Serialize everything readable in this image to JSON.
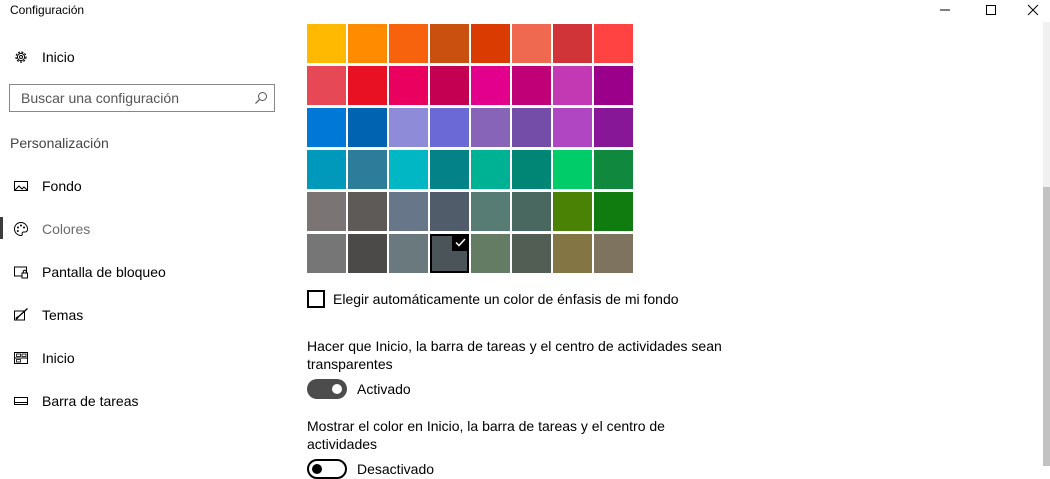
{
  "window": {
    "title": "Configuración"
  },
  "sidebar": {
    "home_label": "Inicio",
    "search_placeholder": "Buscar una configuración",
    "section_title": "Personalización",
    "items": [
      {
        "label": "Fondo",
        "icon": "picture-icon",
        "active": false
      },
      {
        "label": "Colores",
        "icon": "palette-icon",
        "active": true
      },
      {
        "label": "Pantalla de bloqueo",
        "icon": "lock-screen-icon",
        "active": false
      },
      {
        "label": "Temas",
        "icon": "themes-icon",
        "active": false
      },
      {
        "label": "Inicio",
        "icon": "start-icon",
        "active": false
      },
      {
        "label": "Barra de tareas",
        "icon": "taskbar-icon",
        "active": false
      }
    ]
  },
  "colors": {
    "grid": [
      [
        "#FFB900",
        "#FF8C00",
        "#F7630C",
        "#CA5010",
        "#DA3B01",
        "#EF6950",
        "#D13438",
        "#FF4343"
      ],
      [
        "#E74856",
        "#E81123",
        "#EA005E",
        "#C30052",
        "#E3008C",
        "#BF0077",
        "#C239B3",
        "#9A0089"
      ],
      [
        "#0078D7",
        "#0063B1",
        "#8E8CD8",
        "#6B69D6",
        "#8764B8",
        "#744DA9",
        "#B146C2",
        "#881798"
      ],
      [
        "#0099BC",
        "#2D7D9A",
        "#00B7C3",
        "#038387",
        "#00B294",
        "#018574",
        "#00CC6A",
        "#10893E"
      ],
      [
        "#7A7574",
        "#5D5A58",
        "#68768A",
        "#515C6B",
        "#567C73",
        "#486860",
        "#498205",
        "#107C10"
      ],
      [
        "#767676",
        "#4C4A48",
        "#69797E",
        "#4A5459",
        "#647C64",
        "#525E54",
        "#847545",
        "#7E735F"
      ]
    ],
    "selected_row": 5,
    "selected_col": 3
  },
  "auto_accent": {
    "label": "Elegir automáticamente un color de énfasis de mi fondo",
    "checked": false
  },
  "transparency": {
    "line1": "Hacer que Inicio, la barra de tareas y el centro de actividades sean",
    "line2": "transparentes",
    "state_label": "Activado",
    "on": true
  },
  "show_color": {
    "line1": "Mostrar el color en Inicio, la barra de tareas y el centro de",
    "line2": "actividades",
    "state_label": "Desactivado",
    "on": false
  }
}
